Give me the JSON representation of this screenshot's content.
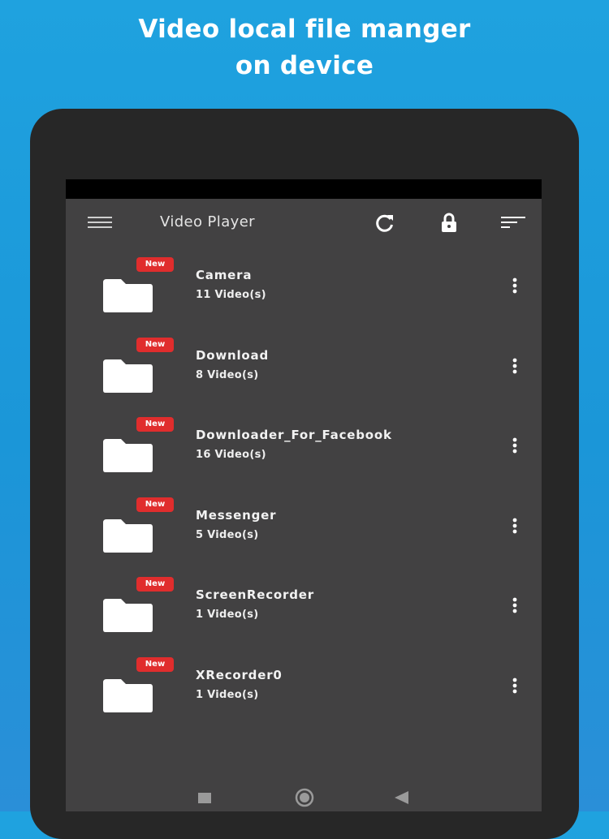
{
  "headline": {
    "line1": "Video local file manger",
    "line2": "on device"
  },
  "app": {
    "title": "Video Player",
    "icons": [
      "menu-icon",
      "refresh-icon",
      "lock-icon",
      "sort-icon"
    ]
  },
  "folders": [
    {
      "name": "Camera",
      "count": "11 Video(s)",
      "badge": "New"
    },
    {
      "name": "Download",
      "count": "8 Video(s)",
      "badge": "New"
    },
    {
      "name": "Downloader_For_Facebook",
      "count": "16 Video(s)",
      "badge": "New"
    },
    {
      "name": "Messenger",
      "count": "5 Video(s)",
      "badge": "New"
    },
    {
      "name": "ScreenRecorder",
      "count": "1 Video(s)",
      "badge": "New"
    },
    {
      "name": "XRecorder0",
      "count": "1 Video(s)",
      "badge": "New"
    }
  ],
  "navbar": {
    "icons": [
      "recents-square-icon",
      "home-circle-icon",
      "back-triangle-icon"
    ]
  },
  "colors": {
    "background": "#1fa2df",
    "device_frame": "#272727",
    "screen": "#424142",
    "badge": "#e02d2d",
    "text": "#f2f2f2"
  }
}
